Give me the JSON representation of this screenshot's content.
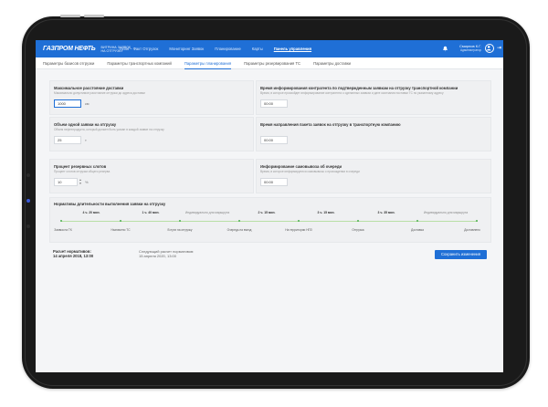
{
  "app": {
    "logo_mark": "ГАЗПРОМ НЕФТЬ",
    "logo_text_line1": "ВИТРИНА ЗАЯВОК",
    "logo_text_line2": "НА ОТГРУЗКУ"
  },
  "nav": {
    "items": [
      {
        "label": "План – Факт Отгрузок",
        "active": false
      },
      {
        "label": "Мониторинг Заявок",
        "active": false
      },
      {
        "label": "Планирование",
        "active": false
      },
      {
        "label": "Карты",
        "active": false
      },
      {
        "label": "Панель управления",
        "active": true
      }
    ]
  },
  "user": {
    "name": "Смирнов К.Г.",
    "role": "Администратор"
  },
  "tabs": [
    {
      "label": "Параметры базисов отгрузки",
      "active": false
    },
    {
      "label": "Параметры транспортных компаний",
      "active": false
    },
    {
      "label": "Параметры планирования",
      "active": true
    },
    {
      "label": "Параметры резервирования ТС",
      "active": false
    },
    {
      "label": "Параметры доставки",
      "active": false
    }
  ],
  "settings": {
    "max_distance": {
      "title": "Максимальное расстояние доставки",
      "desc": "Максимально допустимое расстояние отгрузки до адреса доставки",
      "value": "1000",
      "unit": "км"
    },
    "order_volume": {
      "title": "Объем одной заявки на отгрузку",
      "desc": "Объем нефтепродукта, который должен быть указан в каждой заявке на отгрузку",
      "value": "25",
      "unit": "т"
    },
    "reserve_slots": {
      "title": "Процент резервных слотов",
      "desc": "Процент слотов отгрузки общего резерва",
      "value": "10",
      "unit": "%"
    },
    "contractor_time": {
      "title": "Время информирования контрагента по подтвержденным заявкам на отгрузку транспортной компании",
      "desc": "Время, в которое произойдет информирование контрагента о сделанных заявках и дате окончания поставки ТС по указанному адресу",
      "value": "00:00"
    },
    "package_time": {
      "title": "Время направления пакета заявок на отгрузку в транспортную компанию",
      "desc": "",
      "value": "00:00"
    },
    "self_pickup_time": {
      "title": "Информирование самовывоза об очереди",
      "desc": "Время, в которое информируются самовывозы о прохождении в очереди",
      "value": "00:00"
    }
  },
  "timeline": {
    "title": "Нормативы длительности выполнения заявки на отгрузку",
    "durations": [
      {
        "label": "4 ч. 20 мин.",
        "light": false
      },
      {
        "label": "1 ч. 40 мин.",
        "light": false
      },
      {
        "label": "Индивидуально для маршрута",
        "light": true
      },
      {
        "label": "2 ч. 15 мин.",
        "light": false
      },
      {
        "label": "3 ч. 15 мин.",
        "light": false
      },
      {
        "label": "3 ч. 35 мин.",
        "light": false
      },
      {
        "label": "Индивидуально для маршрута",
        "light": true
      }
    ],
    "stages": [
      "Заявка на ТК",
      "Назначено ТС",
      "В пути на отгрузку",
      "Очередь на въезд",
      "На территории НПЗ",
      "Отгрузка",
      "Доставка",
      "Доставлено"
    ]
  },
  "footer": {
    "last_calc_label": "Расчет нормативов:",
    "last_calc_date": "14 апреля 2018, 13:00",
    "next_calc_label": "Следующий расчет нормативов:",
    "next_calc_date": "15 апреля 2020, 13:00",
    "save_label": "Сохранить изменения"
  },
  "colors": {
    "accent": "#1f6fd6",
    "timeline": "#4caf50"
  }
}
